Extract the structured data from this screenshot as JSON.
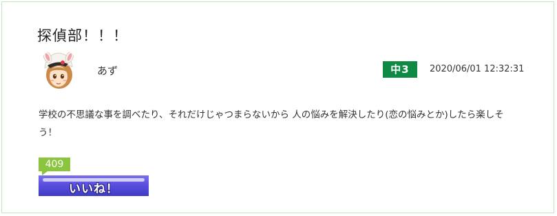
{
  "post": {
    "title": "探偵部！！！",
    "author": "あず",
    "grade": "中3",
    "timestamp": "2020/06/01 12:32:31",
    "body": "学校の不思議な事を調べたり、それだけじゃつまらないから 人の悩みを解決したり(恋の悩みとか)したら楽しそう！"
  },
  "likes": {
    "count": "409",
    "button_label": "いいね！"
  },
  "colors": {
    "card_border": "#bfe6bf",
    "grade_badge": "#0f8a45",
    "like_count_bg": "#8bc540",
    "like_button": "#5a4fe0"
  },
  "icons": {
    "avatar": "avatar-girl-bunny-hat-icon"
  }
}
